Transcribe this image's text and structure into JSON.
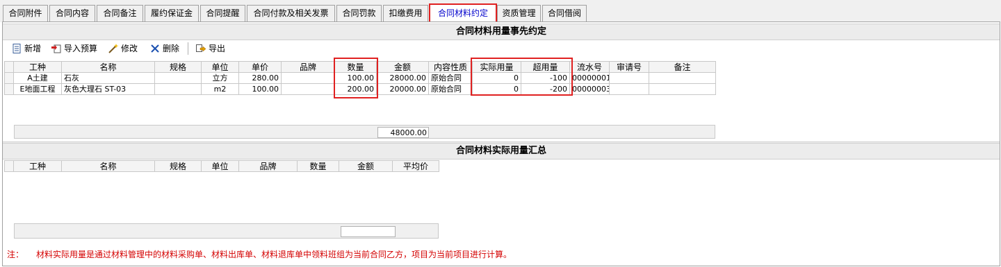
{
  "tabs": [
    {
      "label": "合同附件"
    },
    {
      "label": "合同内容"
    },
    {
      "label": "合同备注"
    },
    {
      "label": "履约保证金"
    },
    {
      "label": "合同提醒"
    },
    {
      "label": "合同付款及相关发票"
    },
    {
      "label": "合同罚款"
    },
    {
      "label": "扣缴费用"
    },
    {
      "label": "合同材料约定"
    },
    {
      "label": "资质管理"
    },
    {
      "label": "合同借阅"
    }
  ],
  "active_tab": "合同材料约定",
  "section1": {
    "title": "合同材料用量事先约定",
    "toolbar": {
      "new_label": "新增",
      "import_label": "导入预算",
      "edit_label": "修改",
      "delete_label": "删除",
      "export_label": "导出"
    },
    "columns": [
      "工种",
      "名称",
      "规格",
      "单位",
      "单价",
      "品牌",
      "数量",
      "金额",
      "内容性质",
      "实际用量",
      "超用量",
      "流水号",
      "审请号",
      "备注"
    ],
    "rows": [
      {
        "trade": "A土建",
        "name": "石灰",
        "spec": "",
        "unit": "立方",
        "price": "280.00",
        "brand": "",
        "qty": "100.00",
        "amount": "28000.00",
        "nature": "原始合同",
        "actual": "0",
        "over": "-100",
        "serial": "00000001",
        "apply": "",
        "remark": ""
      },
      {
        "trade": "E地面工程",
        "name": "灰色大理石 ST-03",
        "spec": "",
        "unit": "m2",
        "price": "100.00",
        "brand": "",
        "qty": "200.00",
        "amount": "20000.00",
        "nature": "原始合同",
        "actual": "0",
        "over": "-200",
        "serial": "00000003",
        "apply": "",
        "remark": ""
      }
    ],
    "total_amount": "48000.00"
  },
  "section2": {
    "title": "合同材料实际用量汇总",
    "columns": [
      "工种",
      "名称",
      "规格",
      "单位",
      "品牌",
      "数量",
      "金额",
      "平均价"
    ],
    "total_amount": ""
  },
  "note": {
    "label": "注：",
    "text": "材料实际用量是通过材料管理中的材料采购单、材料出库单、材料退库单中领料班组为当前合同乙方，项目为当前项目进行计算。"
  },
  "colors": {
    "highlight": "#e02020",
    "note_text": "#d40000",
    "active_tab_text": "#0000cc"
  }
}
